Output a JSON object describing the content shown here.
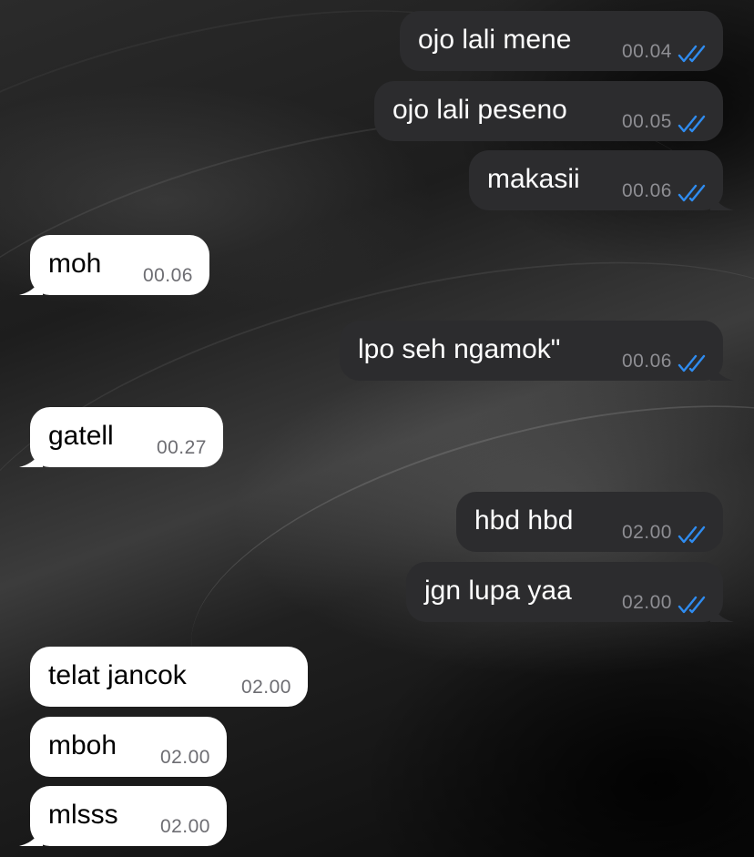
{
  "colors": {
    "outgoing_bubble": "#2c2c2e",
    "incoming_bubble": "#ffffff",
    "read_tick": "#2f8cf0"
  },
  "messages": [
    {
      "direction": "outgoing",
      "text": "ojo lali mene",
      "time": "00.04",
      "status_icon": "double-check-icon"
    },
    {
      "direction": "outgoing",
      "text": "ojo lali peseno",
      "time": "00.05",
      "status_icon": "double-check-icon"
    },
    {
      "direction": "outgoing",
      "text": "makasii",
      "time": "00.06",
      "status_icon": "double-check-icon"
    },
    {
      "direction": "incoming",
      "text": "moh",
      "time": "00.06"
    },
    {
      "direction": "outgoing",
      "text": "lpo seh ngamok\"",
      "time": "00.06",
      "status_icon": "double-check-icon"
    },
    {
      "direction": "incoming",
      "text": "gatell",
      "time": "00.27"
    },
    {
      "direction": "outgoing",
      "text": "hbd hbd",
      "time": "02.00",
      "status_icon": "double-check-icon"
    },
    {
      "direction": "outgoing",
      "text": "jgn lupa yaa",
      "time": "02.00",
      "status_icon": "double-check-icon"
    },
    {
      "direction": "incoming",
      "text": "telat jancok",
      "time": "02.00"
    },
    {
      "direction": "incoming",
      "text": "mboh",
      "time": "02.00"
    },
    {
      "direction": "incoming",
      "text": "mlsss",
      "time": "02.00"
    }
  ]
}
